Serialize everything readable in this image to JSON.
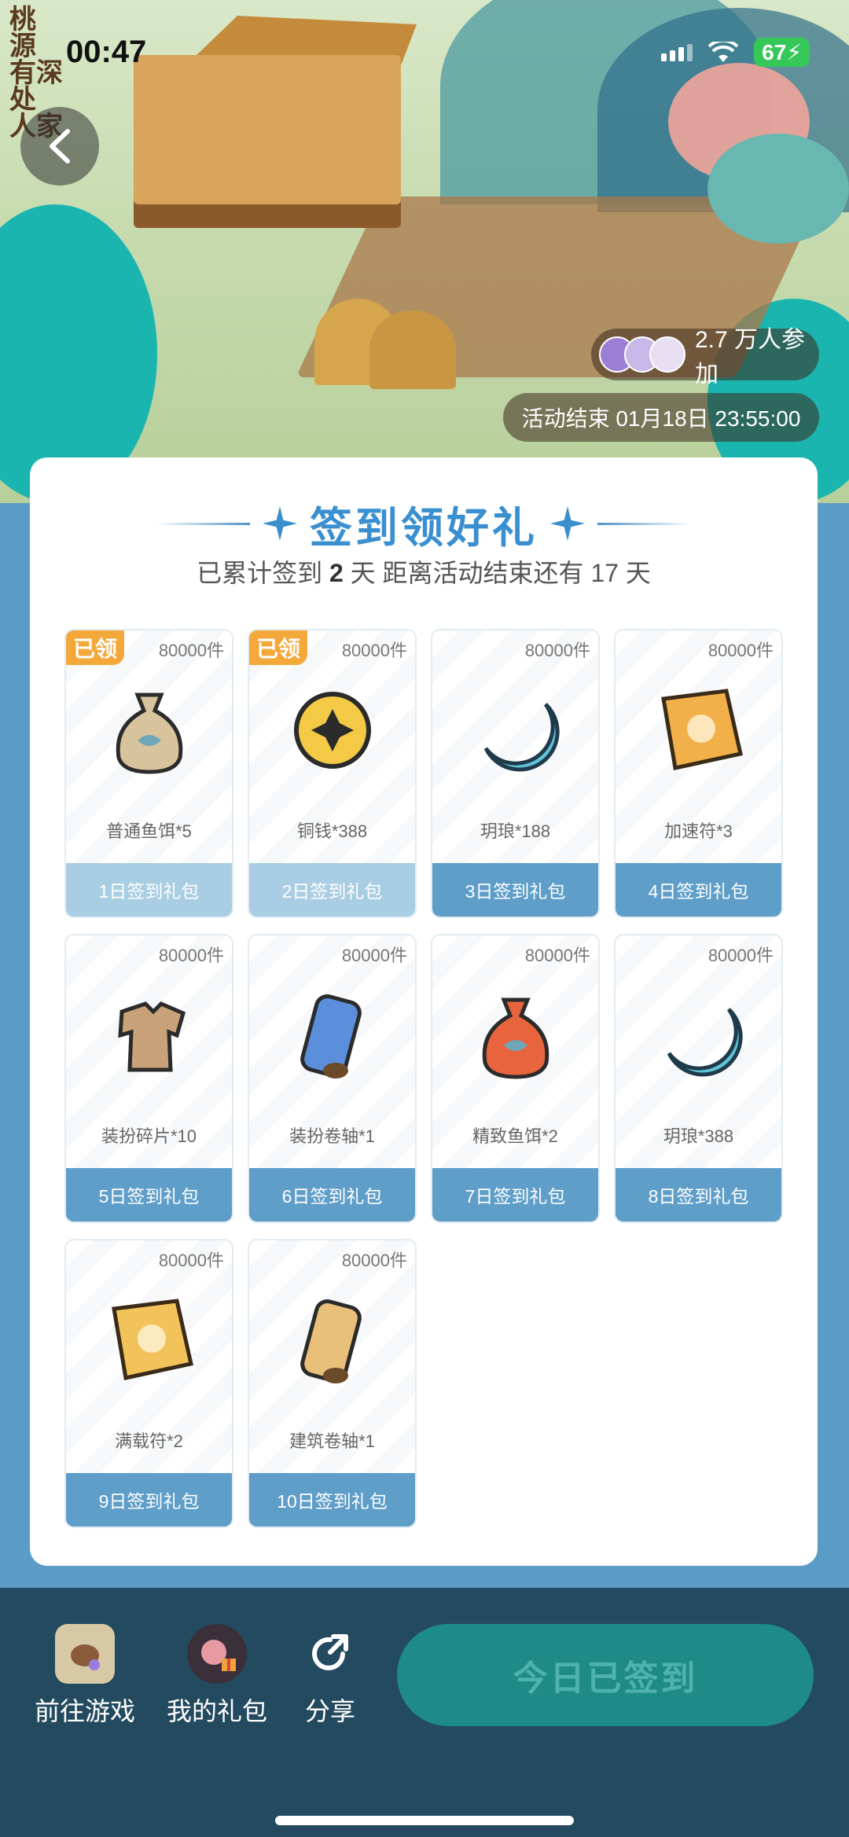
{
  "status": {
    "time": "00:47",
    "battery": "67"
  },
  "banner": {
    "logo_chars": [
      "桃",
      "源",
      "有深处",
      "人家"
    ],
    "participants": "2.7 万人参加",
    "event_end": "活动结束 01月18日 23:55:00"
  },
  "card": {
    "title": "签到领好礼",
    "subtitle_prefix": "已累计签到",
    "days_signed": "2",
    "subtitle_mid": "天  距离活动结束还有 17 天"
  },
  "rewards": [
    {
      "badge": "已领",
      "stock": "80000件",
      "name": "普通鱼饵*5",
      "footer": "1日签到礼包",
      "icon": "fish-bait-bag-icon",
      "color": "#d8c49c"
    },
    {
      "badge": "已领",
      "stock": "80000件",
      "name": "铜钱*388",
      "footer": "2日签到礼包",
      "icon": "coin-icon",
      "color": "#f3c945"
    },
    {
      "stock": "80000件",
      "name": "玥琅*188",
      "footer": "3日签到礼包",
      "icon": "moon-gem-icon",
      "color": "#5fc3d8"
    },
    {
      "stock": "80000件",
      "name": "加速符*3",
      "footer": "4日签到礼包",
      "icon": "speed-talisman-icon",
      "color": "#f2b04a"
    },
    {
      "stock": "80000件",
      "name": "装扮碎片*10",
      "footer": "5日签到礼包",
      "icon": "outfit-fragment-icon",
      "color": "#c9a27a"
    },
    {
      "stock": "80000件",
      "name": "装扮卷轴*1",
      "footer": "6日签到礼包",
      "icon": "outfit-scroll-icon",
      "color": "#5b8fdc"
    },
    {
      "stock": "80000件",
      "name": "精致鱼饵*2",
      "footer": "7日签到礼包",
      "icon": "fine-bait-bag-icon",
      "color": "#e8643c"
    },
    {
      "stock": "80000件",
      "name": "玥琅*388",
      "footer": "8日签到礼包",
      "icon": "moon-gem-icon",
      "color": "#5fc3d8"
    },
    {
      "stock": "80000件",
      "name": "满载符*2",
      "footer": "9日签到礼包",
      "icon": "full-load-talisman-icon",
      "color": "#f1c35a"
    },
    {
      "stock": "80000件",
      "name": "建筑卷轴*1",
      "footer": "10日签到礼包",
      "icon": "building-scroll-icon",
      "color": "#e8c07a"
    }
  ],
  "bottom": {
    "go_game": "前往游戏",
    "my_gifts": "我的礼包",
    "share": "分享",
    "checkin": "今日已签到"
  }
}
